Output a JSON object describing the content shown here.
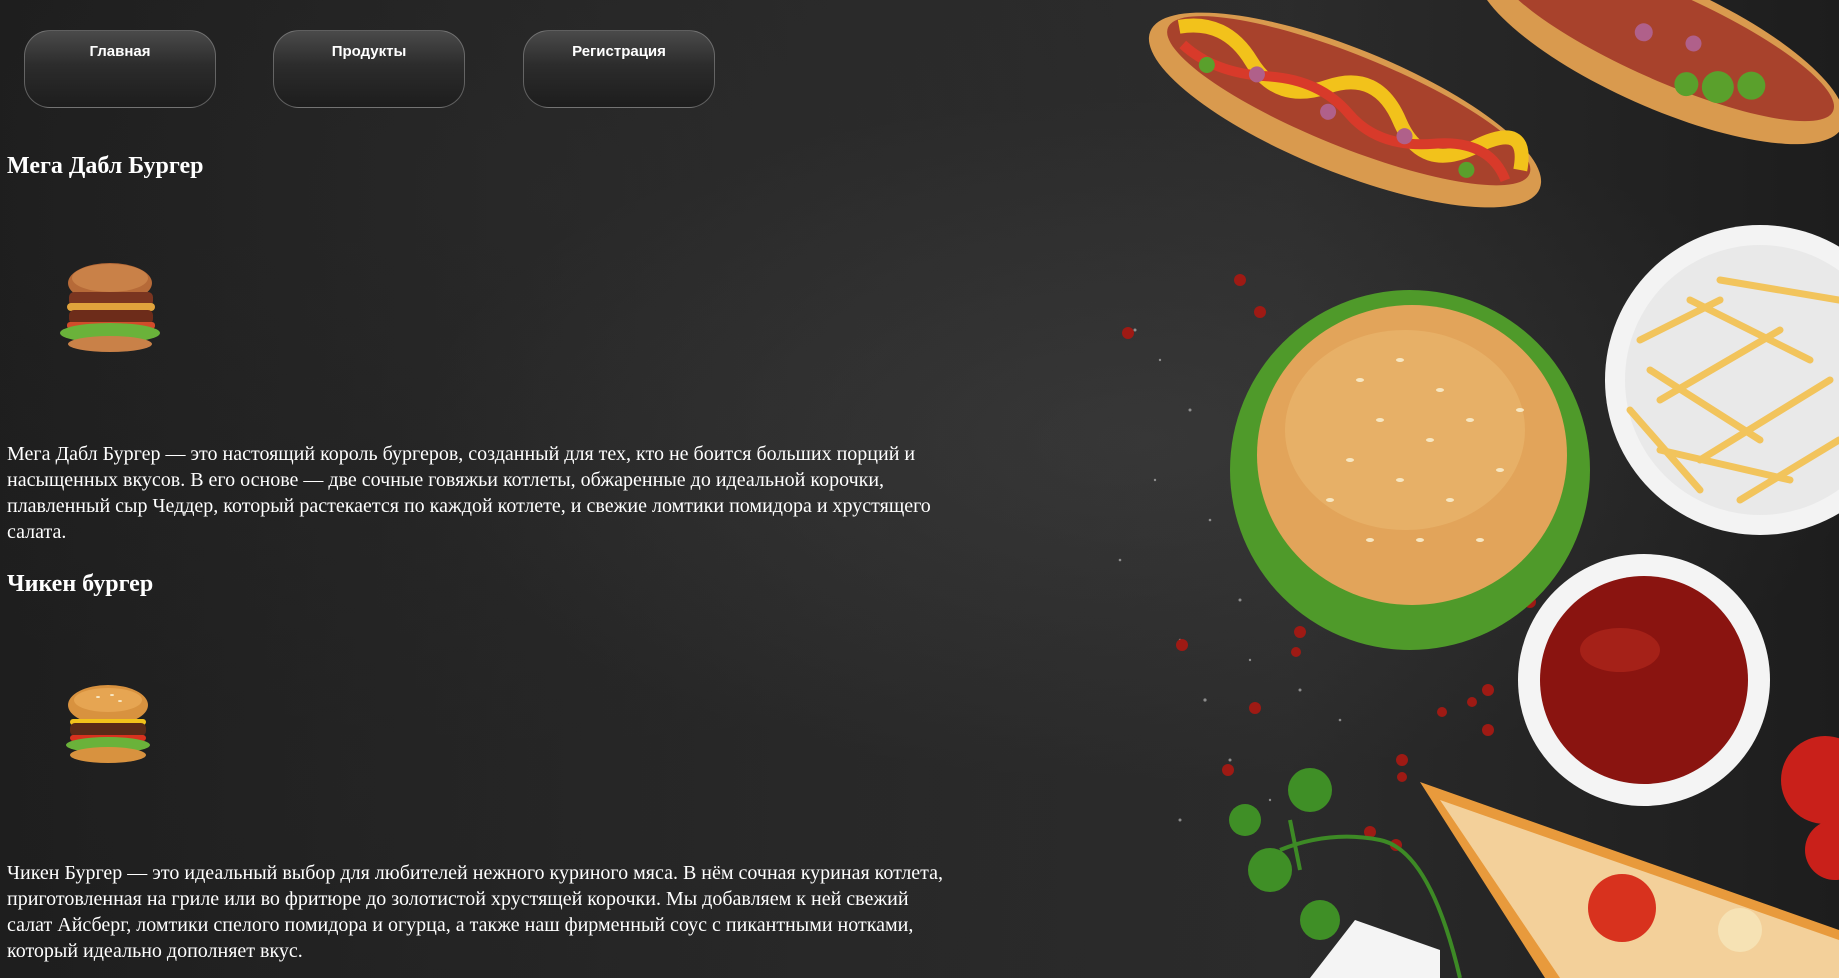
{
  "nav": {
    "items": [
      {
        "label": "Главная"
      },
      {
        "label": "Продукты"
      },
      {
        "label": "Регистрация"
      }
    ]
  },
  "products": [
    {
      "title": "Мега Дабл Бургер",
      "image_icon": "double-burger-image",
      "description": "Мега Дабл Бургер — это настоящий король бургеров, созданный для тех, кто не боится больших порций и насыщенных вкусов. В его основе — две сочные говяжьи котлеты, обжаренные до идеальной корочки, плавленный сыр Чеддер, который растекается по каждой котлете, и свежие ломтики помидора и хрустящего салата."
    },
    {
      "title": "Чикен бургер",
      "image_icon": "chicken-burger-image",
      "description": "Чикен Бургер — это идеальный выбор для любителей нежного куриного мяса. В нём сочная куриная котлета, приготовленная на гриле или во фритюре до золотистой хрустящей корочки. Мы добавляем к ней свежий салат Айсберг, ломтики спелого помидора и огурца, а также наш фирменный соус с пикантными нотками, который идеально дополняет вкус."
    }
  ],
  "colors": {
    "background": "#1e1e1e",
    "text": "#ffffff",
    "nav_border": "#969696"
  }
}
